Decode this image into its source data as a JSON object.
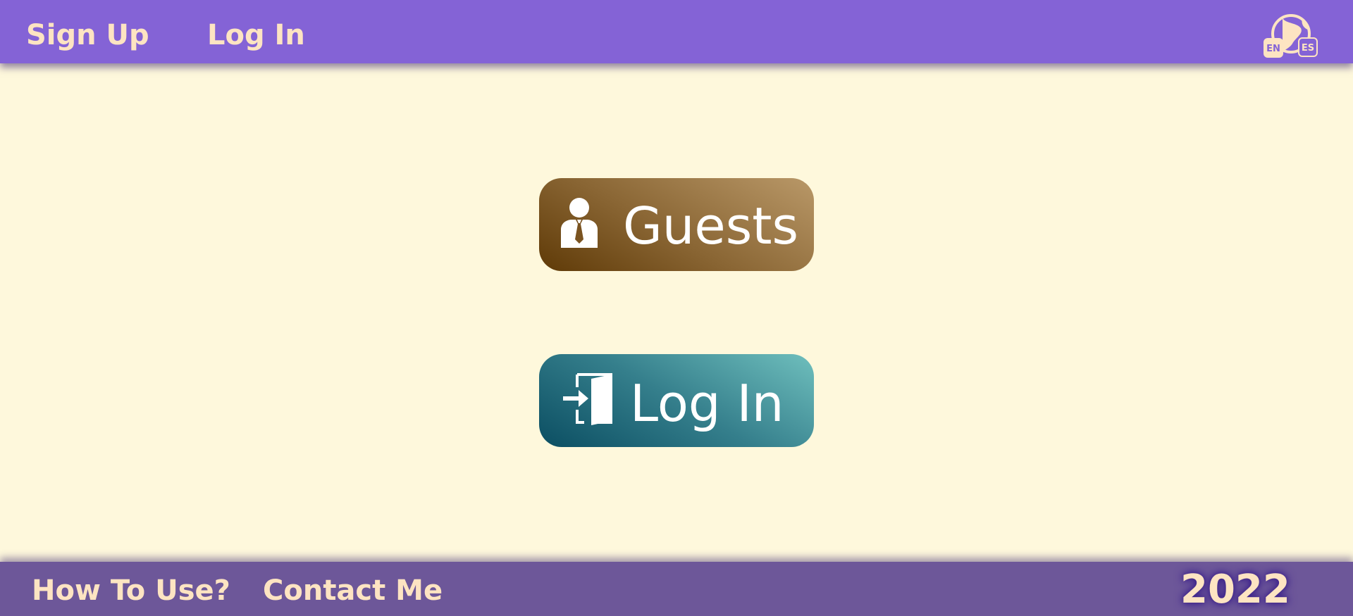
{
  "header": {
    "nav": {
      "signup": "Sign Up",
      "login": "Log In"
    },
    "language": {
      "icon": "language-switch-icon",
      "options": [
        "EN",
        "ES"
      ]
    }
  },
  "main": {
    "guests_button": {
      "label": "Guests",
      "icon": "guest-user-icon"
    },
    "login_button": {
      "label": "Log In",
      "icon": "enter-door-icon"
    }
  },
  "footer": {
    "how_to": "How To Use?",
    "contact": "Contact Me",
    "year": "2022"
  },
  "colors": {
    "header_bg": "#8463d6",
    "page_bg": "#fef8dc",
    "footer_bg": "#6d5799",
    "nav_text": "#fde4c2",
    "guests_gradient": [
      "#5f3a07",
      "#b99868"
    ],
    "login_gradient": [
      "#0b4e62",
      "#6fbfbd"
    ]
  }
}
